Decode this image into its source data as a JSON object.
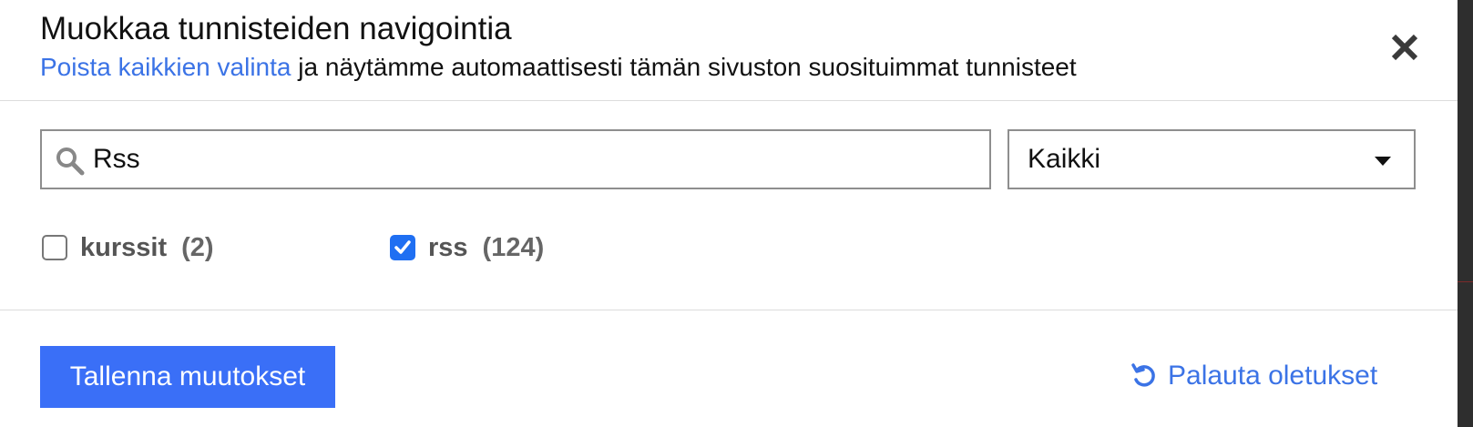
{
  "dialog": {
    "title": "Muokkaa tunnisteiden navigointia",
    "subtitle_link": "Poista kaikkien valinta",
    "subtitle_rest": " ja näytämme automaattisesti tämän sivuston suosituimmat tunnisteet"
  },
  "search": {
    "value": "Rss",
    "icon": "search-icon"
  },
  "filter": {
    "selected": "Kaikki"
  },
  "tags": [
    {
      "name": "kurssit",
      "count": "(2)",
      "checked": false
    },
    {
      "name": "rss",
      "count": "(124)",
      "checked": true
    }
  ],
  "footer": {
    "save_label": "Tallenna muutokset",
    "reset_label": "Palauta oletukset"
  },
  "colors": {
    "accent": "#3a6ff7",
    "link": "#3b73e6",
    "checkbox_checked": "#1f6ff2"
  }
}
